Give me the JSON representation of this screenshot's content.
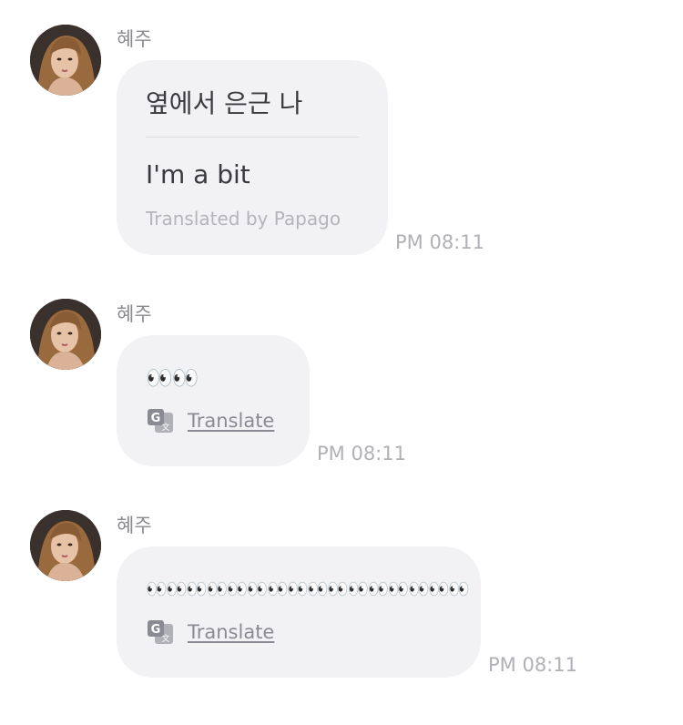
{
  "messages": [
    {
      "sender": "혜주",
      "original": "옆에서 은근 나",
      "translated": "I'm a bit",
      "translated_by": "Translated by Papago",
      "time": "PM 08:11"
    },
    {
      "sender": "혜주",
      "text": "👀👀",
      "translate_label": "Translate",
      "time": "PM 08:11"
    },
    {
      "sender": "혜주",
      "text": "👀👀👀👀👀👀👀👀👀👀👀👀👀👀👀👀",
      "translate_label": "Translate",
      "time": "PM 08:11"
    }
  ]
}
